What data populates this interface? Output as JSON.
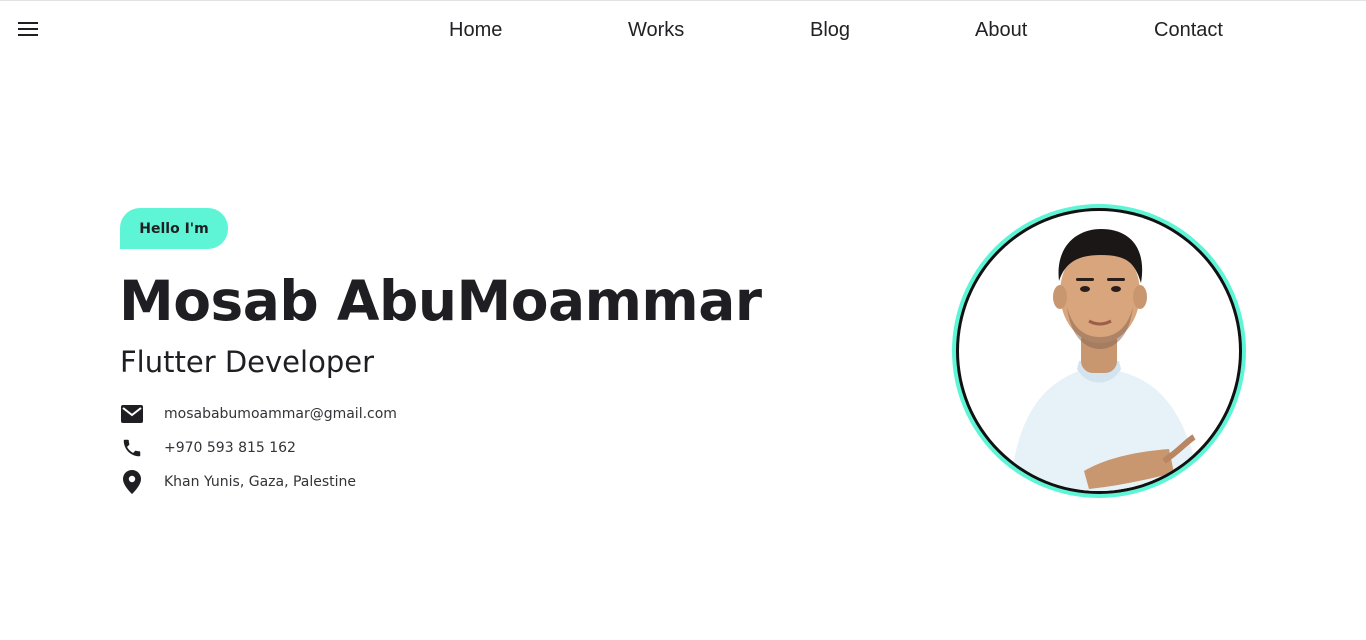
{
  "nav": {
    "menu_icon": "menu-icon",
    "items": [
      {
        "label": "Home"
      },
      {
        "label": "Works"
      },
      {
        "label": "Blog"
      },
      {
        "label": "About"
      },
      {
        "label": "Contact"
      }
    ]
  },
  "hero": {
    "greeting": "Hello I'm",
    "name": "Mosab AbuMoammar",
    "role": "Flutter Developer",
    "contacts": [
      {
        "icon": "email-icon",
        "text": "mosababumoammar@gmail.com"
      },
      {
        "icon": "phone-icon",
        "text": "+970 593 815 162"
      },
      {
        "icon": "location-pin-icon",
        "text": "Khan Yunis, Gaza, Palestine"
      }
    ]
  },
  "avatar": {
    "icon": "profile-photo"
  },
  "colors": {
    "accent": "#5ef5d6",
    "text": "#1f1f23",
    "ring": "#111111"
  }
}
